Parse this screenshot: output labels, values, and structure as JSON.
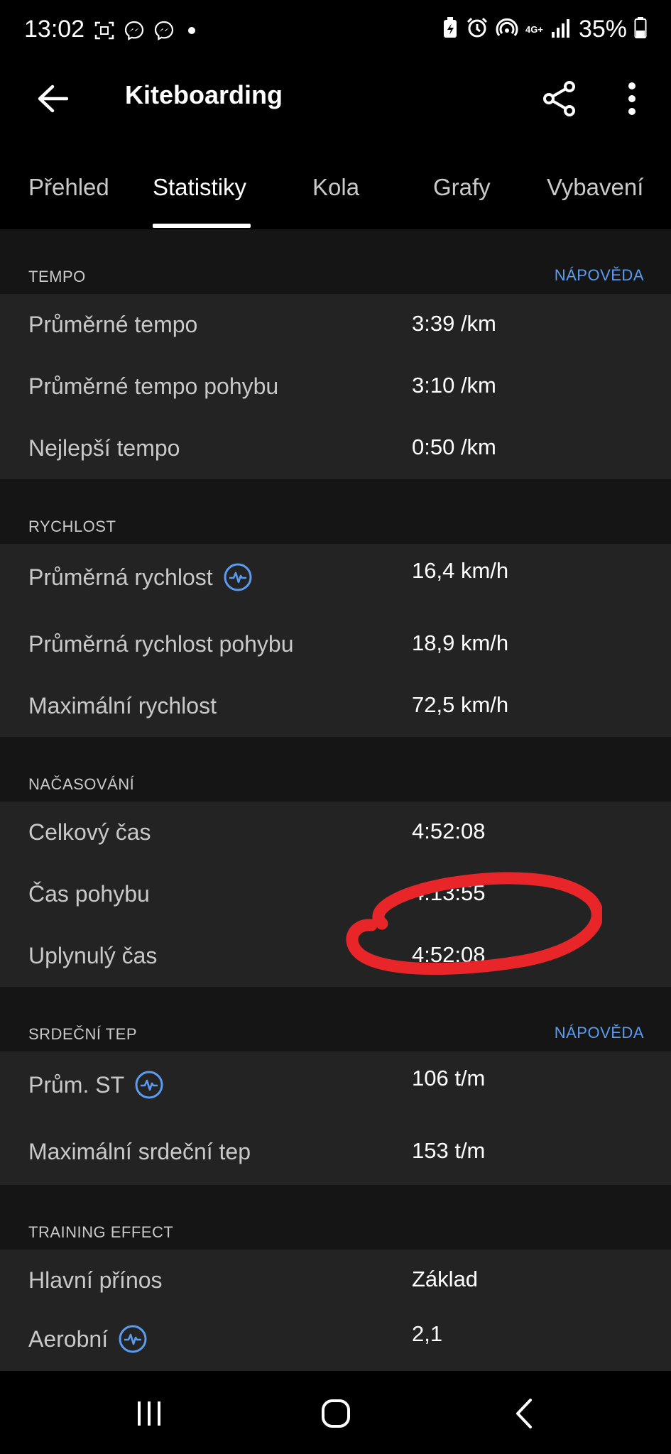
{
  "status_bar": {
    "time": "13:02",
    "network": "4G+",
    "battery": "35%",
    "icons": [
      "screenshot-icon",
      "messenger-icon",
      "messenger-icon",
      "dot-icon",
      "battery-saver-icon",
      "alarm-icon",
      "hotspot-icon",
      "signal-icon",
      "battery-icon"
    ]
  },
  "app_bar": {
    "title": "Kiteboarding",
    "back_icon": "arrow-left-icon",
    "share_icon": "share-icon",
    "more_icon": "more-vertical-icon"
  },
  "tabs": {
    "items": [
      "Přehled",
      "Statistiky",
      "Kola",
      "Grafy",
      "Vybavení"
    ],
    "active": "Statistiky"
  },
  "sections": {
    "tempo": {
      "title": "TEMPO",
      "help": "NÁPOVĚDA",
      "rows": [
        {
          "label": "Průměrné tempo",
          "value": "3:39 /km"
        },
        {
          "label": "Průměrné tempo pohybu",
          "value": "3:10 /km"
        },
        {
          "label": "Nejlepší tempo",
          "value": "0:50 /km"
        }
      ]
    },
    "speed": {
      "title": "RYCHLOST",
      "rows": [
        {
          "label": "Průměrná rychlost",
          "value": "16,4 km/h"
        },
        {
          "label": "Průměrná rychlost pohybu",
          "value": "18,9 km/h"
        },
        {
          "label": "Maximální rychlost",
          "value": "72,5 km/h"
        }
      ]
    },
    "timing": {
      "title": "NAČASOVÁNÍ",
      "rows": [
        {
          "label": "Celkový čas",
          "value": "4:52:08"
        },
        {
          "label": "Čas pohybu",
          "value": "4:13:55"
        },
        {
          "label": "Uplynulý čas",
          "value": "4:52:08"
        }
      ]
    },
    "heart_rate": {
      "title": "SRDEČNÍ TEP",
      "help": "NÁPOVĚDA",
      "rows": [
        {
          "label": "Prům. ST",
          "value": "106 t/m"
        },
        {
          "label": "Maximální srdeční tep",
          "value": "153 t/m"
        }
      ]
    },
    "training_effect": {
      "title": "TRAINING EFFECT",
      "rows": [
        {
          "label": "Hlavní přínos",
          "value": "Základ"
        },
        {
          "label": "Aerobní",
          "value": "2,1"
        }
      ]
    }
  },
  "colors": {
    "accent": "#5b9bf0",
    "annotation": "#e8262a",
    "section_bg": "#232323",
    "page_bg": "#151515"
  },
  "nav_bar": {
    "icons": [
      "recent-apps-icon",
      "home-icon",
      "back-icon"
    ]
  }
}
